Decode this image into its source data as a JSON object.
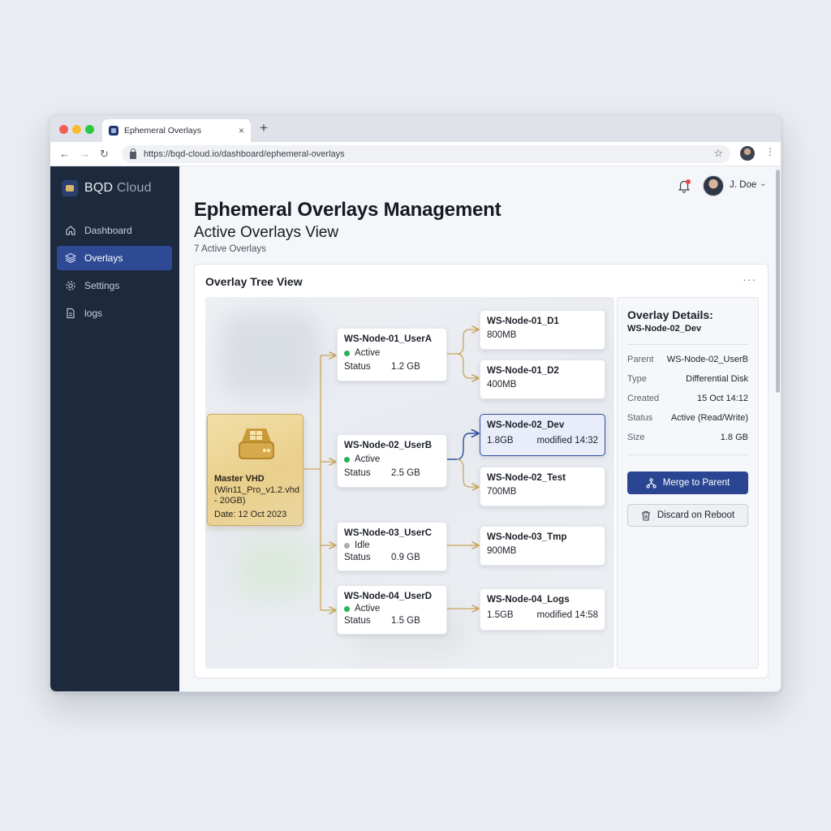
{
  "browser": {
    "tab_title": "Ephemeral Overlays",
    "tab_close": "×",
    "new_tab": "+",
    "url": "https://bqd-cloud.io/dashboard/ephemeral-overlays",
    "back": "←",
    "forward": "→",
    "reload": "↻",
    "bookmark": "☆",
    "menu": "⋮"
  },
  "sidebar": {
    "brand_bold": "BQD",
    "brand_light": " Cloud",
    "items": [
      {
        "label": "Dashboard",
        "icon": "home-icon"
      },
      {
        "label": "Overlays",
        "icon": "layers-icon",
        "active": true
      },
      {
        "label": "Settings",
        "icon": "gear-icon"
      },
      {
        "label": "logs",
        "icon": "document-icon"
      }
    ]
  },
  "header": {
    "user_name": "J. Doe",
    "chevron": "⌄"
  },
  "page": {
    "title": "Ephemeral Overlays Management",
    "subtitle": "Active Overlays View",
    "count": "7 Active Overlays"
  },
  "card": {
    "title": "Overlay Tree View",
    "more": "···"
  },
  "master": {
    "title": "Master VHD",
    "file": "(Win11_Pro_v1.2.vhd - 20GB)",
    "date": "Date: 12 Oct 2023"
  },
  "nodes": [
    {
      "name": "WS-Node-01_UserA",
      "status": "Active",
      "status_label": "Status",
      "size": "1.2 GB"
    },
    {
      "name": "WS-Node-02_UserB",
      "status": "Active",
      "status_label": "Status",
      "size": "2.5 GB"
    },
    {
      "name": "WS-Node-03_UserC",
      "status": "Idle",
      "status_label": "Status",
      "size": "0.9 GB"
    },
    {
      "name": "WS-Node-04_UserD",
      "status": "Active",
      "status_label": "Status",
      "size": "1.5 GB"
    }
  ],
  "leaves": [
    {
      "name": "WS-Node-01_D1",
      "size": "800MB",
      "modified": ""
    },
    {
      "name": "WS-Node-01_D2",
      "size": "400MB",
      "modified": ""
    },
    {
      "name": "WS-Node-02_Dev",
      "size": "1.8GB",
      "modified": "modified 14:32",
      "selected": true
    },
    {
      "name": "WS-Node-02_Test",
      "size": "700MB",
      "modified": ""
    },
    {
      "name": "WS-Node-03_Tmp",
      "size": "900MB",
      "modified": ""
    },
    {
      "name": "WS-Node-04_Logs",
      "size": "1.5GB",
      "modified": "modified 14:58"
    }
  ],
  "details": {
    "title": "Overlay Details:",
    "subject": "WS-Node-02_Dev",
    "rows": [
      {
        "key": "Parent",
        "value": "WS-Node-02_UserB"
      },
      {
        "key": "Type",
        "value": "Differential Disk"
      },
      {
        "key": "Created",
        "value": "15 Oct 14:12"
      },
      {
        "key": "Status",
        "value": "Active (Read/Write)"
      },
      {
        "key": "Size",
        "value": "1.8 GB"
      }
    ],
    "merge_label": "Merge to Parent",
    "discard_label": "Discard on Reboot"
  },
  "colors": {
    "sidebar_bg": "#1d2a3e",
    "accent": "#2a4692",
    "master_gold": "#e9cf8b",
    "connector": "#c9a45a",
    "connector_selected": "#2f4e9e",
    "active_green": "#22b455",
    "idle_gray": "#a9adb4"
  }
}
